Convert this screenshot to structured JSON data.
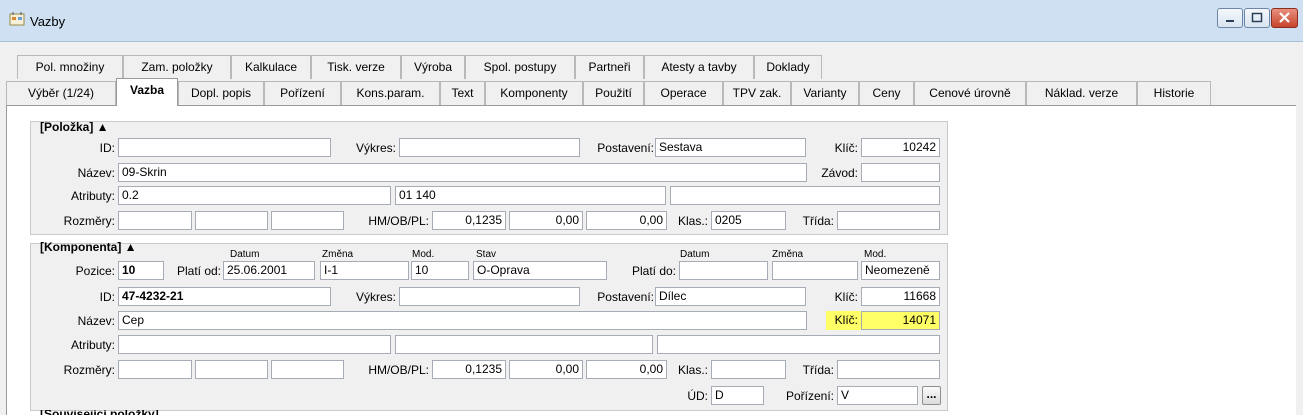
{
  "window": {
    "title": "Vazby"
  },
  "tabs_row1": [
    "Pol. množiny",
    "Zam. položky",
    "Kalkulace",
    "Tisk. verze",
    "Výroba",
    "Spol. postupy",
    "Partneři",
    "Atesty a tavby",
    "Doklady"
  ],
  "tabs_row2": [
    "Výběr (1/24)",
    "Vazba",
    "Dopl. popis",
    "Pořízení",
    "Kons.param.",
    "Text",
    "Komponenty",
    "Použití",
    "Operace",
    "TPV zak.",
    "Varianty",
    "Ceny",
    "Cenové úrovně",
    "Náklad. verze",
    "Historie"
  ],
  "polozka": {
    "header": "[Položka] ▲",
    "labels": {
      "id": "ID:",
      "vykres": "Výkres:",
      "postaveni": "Postavení:",
      "klic": "Klíč:",
      "nazev": "Název:",
      "zavod": "Závod:",
      "atributy": "Atributy:",
      "rozmery": "Rozměry:",
      "hmobpl": "HM/OB/PL:",
      "klas": "Klas.:",
      "trida": "Třída:"
    },
    "id": "",
    "vykres": "",
    "postaveni": "Sestava",
    "klic": "10242",
    "nazev": "09-Skrin",
    "zavod": "",
    "atributy": [
      "0.2",
      "01 140",
      ""
    ],
    "rozmery": [
      "",
      "",
      ""
    ],
    "hm": "0,1235",
    "ob": "0,00",
    "pl": "0,00",
    "klas": "0205",
    "trida": ""
  },
  "komponenta": {
    "header": "[Komponenta] ▲",
    "captions": {
      "datum": "Datum",
      "zmena": "Změna",
      "mod": "Mod.",
      "stav": "Stav",
      "datum2": "Datum",
      "zmena2": "Změna",
      "mod2": "Mod."
    },
    "labels": {
      "pozice": "Pozice:",
      "plati_od": "Platí od:",
      "plati_do": "Platí do:",
      "id": "ID:",
      "vykres": "Výkres:",
      "postaveni": "Postavení:",
      "klic": "Klíč:",
      "klic2": "Klíč:",
      "nazev": "Název:",
      "atributy": "Atributy:",
      "rozmery": "Rozměry:",
      "hmobpl": "HM/OB/PL:",
      "klas": "Klas.:",
      "trida": "Třída:",
      "ud": "ÚD:",
      "porizeni": "Pořízení:"
    },
    "pozice": "10",
    "datum": "25.06.2001",
    "zmena": "I-1",
    "mod": "10",
    "stav": "O-Oprava",
    "plati_do_datum": "",
    "plati_do_zmena": "",
    "plati_do_mod": "Neomezeně",
    "id": "47-4232-21",
    "vykres": "",
    "postaveni": "Dílec",
    "klic": "11668",
    "nazev": "Cep",
    "klic2": "14071",
    "atributy": [
      "",
      "",
      ""
    ],
    "rozmery": [
      "",
      "",
      ""
    ],
    "hm": "0,1235",
    "ob": "0,00",
    "pl": "0,00",
    "klas": "",
    "trida": "",
    "ud": "D",
    "porizeni": "V",
    "browse_label": "..."
  },
  "next_group_partial": "[Související položky]"
}
